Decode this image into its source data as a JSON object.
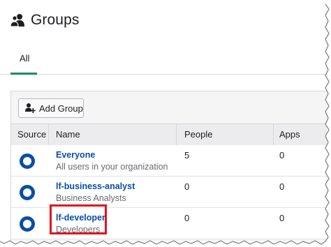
{
  "header": {
    "title": "Groups",
    "icon": "groups-icon"
  },
  "tabs": [
    {
      "label": "All",
      "active": true
    }
  ],
  "toolbar": {
    "add_group_label": "Add Group",
    "add_group_icon": "add-user-icon"
  },
  "table": {
    "columns": [
      "Source",
      "Name",
      "People",
      "Apps"
    ],
    "rows": [
      {
        "name": "Everyone",
        "description": "All users in your organization",
        "people": "5",
        "apps": "0"
      },
      {
        "name": "lf-business-analyst",
        "description": "Business Analysts",
        "people": "0",
        "apps": "0"
      },
      {
        "name": "lf-developer",
        "description": "Developers",
        "people": "0",
        "apps": "0"
      }
    ]
  },
  "colors": {
    "accent": "#1a8c5f",
    "link": "#0a4da8",
    "highlight": "#e0141e"
  }
}
